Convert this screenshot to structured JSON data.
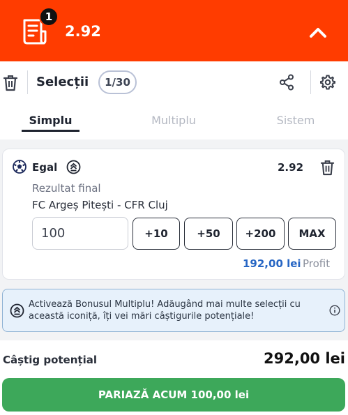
{
  "header": {
    "badge_count": "1",
    "total_odds": "2.92"
  },
  "toolbar": {
    "title": "Selecții",
    "counter": "1/30"
  },
  "tabs": [
    {
      "label": "Simplu",
      "active": true
    },
    {
      "label": "Multiplu",
      "active": false
    },
    {
      "label": "Sistem",
      "active": false
    }
  ],
  "selection": {
    "pick": "Egal",
    "odds": "2.92",
    "market": "Rezultat final",
    "event": "FC Argeș Pitești - CFR Cluj",
    "stake_value": "100",
    "quick_stakes": [
      "+10",
      "+50",
      "+200",
      "MAX"
    ],
    "profit_value": "192,00 lei",
    "profit_label": "Profit"
  },
  "bonus_banner": {
    "text": "Activează Bonusul Multiplu! Adăugând mai multe selecții cu această iconiță, îți vei mări câștigurile potențiale!"
  },
  "footer": {
    "potential_label": "Câștig potențial",
    "potential_amount": "292,00 lei",
    "bet_button": "PARIAZĂ ACUM 100,00 lei"
  },
  "colors": {
    "header_bg": "#ff3c00",
    "accent_blue": "#2766c4",
    "bet_green": "#3da85a"
  }
}
